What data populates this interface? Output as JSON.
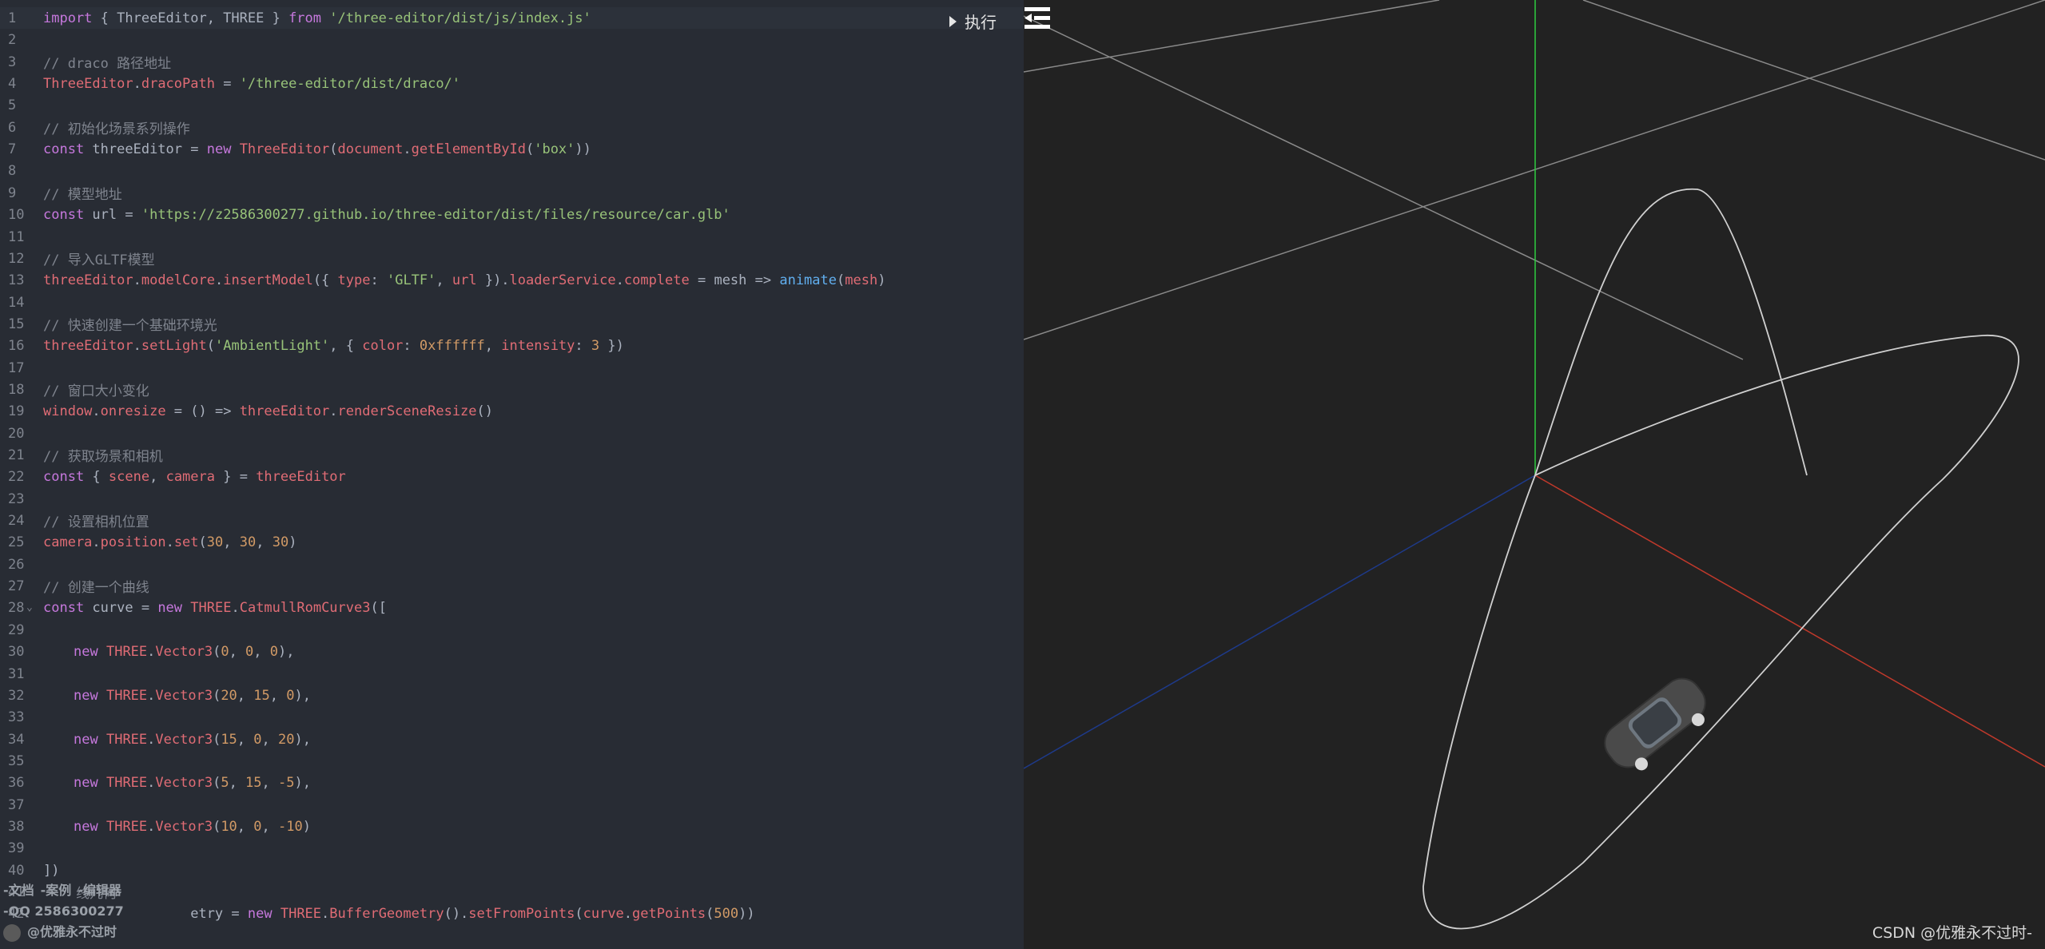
{
  "editor": {
    "lines": [
      {
        "n": "1",
        "active": true,
        "tokens": [
          [
            "kw",
            "import"
          ],
          [
            "pl",
            " { ThreeEditor, THREE } "
          ],
          [
            "kw",
            "from"
          ],
          [
            "pl",
            " "
          ],
          [
            "str",
            "'/three-editor/dist/js/index.js'"
          ]
        ]
      },
      {
        "n": "2",
        "tokens": []
      },
      {
        "n": "3",
        "tokens": [
          [
            "cm",
            "// draco 路径地址"
          ]
        ]
      },
      {
        "n": "4",
        "tokens": [
          [
            "vr",
            "ThreeEditor"
          ],
          [
            "pl",
            "."
          ],
          [
            "vr",
            "dracoPath"
          ],
          [
            "pl",
            " = "
          ],
          [
            "str",
            "'/three-editor/dist/draco/'"
          ]
        ]
      },
      {
        "n": "5",
        "tokens": []
      },
      {
        "n": "6",
        "tokens": [
          [
            "cm",
            "// 初始化场景系列操作"
          ]
        ]
      },
      {
        "n": "7",
        "tokens": [
          [
            "kw",
            "const"
          ],
          [
            "pl",
            " threeEditor = "
          ],
          [
            "kw",
            "new"
          ],
          [
            "pl",
            " "
          ],
          [
            "vr",
            "ThreeEditor"
          ],
          [
            "pl",
            "("
          ],
          [
            "vr",
            "document"
          ],
          [
            "pl",
            "."
          ],
          [
            "vr",
            "getElementById"
          ],
          [
            "pl",
            "("
          ],
          [
            "str",
            "'box'"
          ],
          [
            "pl",
            "))"
          ]
        ]
      },
      {
        "n": "8",
        "tokens": []
      },
      {
        "n": "9",
        "tokens": [
          [
            "cm",
            "// 模型地址"
          ]
        ]
      },
      {
        "n": "10",
        "tokens": [
          [
            "kw",
            "const"
          ],
          [
            "pl",
            " url = "
          ],
          [
            "str",
            "'https://z2586300277.github.io/three-editor/dist/files/resource/car.glb'"
          ]
        ]
      },
      {
        "n": "11",
        "tokens": []
      },
      {
        "n": "12",
        "tokens": [
          [
            "cm",
            "// 导入GLTF模型"
          ]
        ]
      },
      {
        "n": "13",
        "tokens": [
          [
            "vr",
            "threeEditor"
          ],
          [
            "pl",
            "."
          ],
          [
            "vr",
            "modelCore"
          ],
          [
            "pl",
            "."
          ],
          [
            "vr",
            "insertModel"
          ],
          [
            "pl",
            "({ "
          ],
          [
            "vr",
            "type"
          ],
          [
            "pl",
            ": "
          ],
          [
            "str",
            "'GLTF'"
          ],
          [
            "pl",
            ", "
          ],
          [
            "vr",
            "url"
          ],
          [
            "pl",
            " })."
          ],
          [
            "vr",
            "loaderService"
          ],
          [
            "pl",
            "."
          ],
          [
            "vr",
            "complete"
          ],
          [
            "pl",
            " = mesh => "
          ],
          [
            "fn",
            "animate"
          ],
          [
            "pl",
            "("
          ],
          [
            "vr",
            "mesh"
          ],
          [
            "pl",
            ")"
          ]
        ]
      },
      {
        "n": "14",
        "tokens": []
      },
      {
        "n": "15",
        "tokens": [
          [
            "cm",
            "// 快速创建一个基础环境光"
          ]
        ]
      },
      {
        "n": "16",
        "tokens": [
          [
            "vr",
            "threeEditor"
          ],
          [
            "pl",
            "."
          ],
          [
            "vr",
            "setLight"
          ],
          [
            "pl",
            "("
          ],
          [
            "str",
            "'AmbientLight'"
          ],
          [
            "pl",
            ", { "
          ],
          [
            "vr",
            "color"
          ],
          [
            "pl",
            ": "
          ],
          [
            "num",
            "0xffffff"
          ],
          [
            "pl",
            ", "
          ],
          [
            "vr",
            "intensity"
          ],
          [
            "pl",
            ": "
          ],
          [
            "num",
            "3"
          ],
          [
            "pl",
            " })"
          ]
        ]
      },
      {
        "n": "17",
        "tokens": []
      },
      {
        "n": "18",
        "tokens": [
          [
            "cm",
            "// 窗口大小变化"
          ]
        ]
      },
      {
        "n": "19",
        "tokens": [
          [
            "vr",
            "window"
          ],
          [
            "pl",
            "."
          ],
          [
            "vr",
            "onresize"
          ],
          [
            "pl",
            " = () => "
          ],
          [
            "vr",
            "threeEditor"
          ],
          [
            "pl",
            "."
          ],
          [
            "vr",
            "renderSceneResize"
          ],
          [
            "pl",
            "()"
          ]
        ]
      },
      {
        "n": "20",
        "tokens": []
      },
      {
        "n": "21",
        "tokens": [
          [
            "cm",
            "// 获取场景和相机"
          ]
        ]
      },
      {
        "n": "22",
        "tokens": [
          [
            "kw",
            "const"
          ],
          [
            "pl",
            " { "
          ],
          [
            "vr",
            "scene"
          ],
          [
            "pl",
            ", "
          ],
          [
            "vr",
            "camera"
          ],
          [
            "pl",
            " } = "
          ],
          [
            "vr",
            "threeEditor"
          ]
        ]
      },
      {
        "n": "23",
        "tokens": []
      },
      {
        "n": "24",
        "tokens": [
          [
            "cm",
            "// 设置相机位置"
          ]
        ]
      },
      {
        "n": "25",
        "tokens": [
          [
            "vr",
            "camera"
          ],
          [
            "pl",
            "."
          ],
          [
            "vr",
            "position"
          ],
          [
            "pl",
            "."
          ],
          [
            "vr",
            "set"
          ],
          [
            "pl",
            "("
          ],
          [
            "num",
            "30"
          ],
          [
            "pl",
            ", "
          ],
          [
            "num",
            "30"
          ],
          [
            "pl",
            ", "
          ],
          [
            "num",
            "30"
          ],
          [
            "pl",
            ")"
          ]
        ]
      },
      {
        "n": "26",
        "tokens": []
      },
      {
        "n": "27",
        "tokens": [
          [
            "cm",
            "// 创建一个曲线"
          ]
        ]
      },
      {
        "n": "28",
        "fold": true,
        "tokens": [
          [
            "kw",
            "const"
          ],
          [
            "pl",
            " curve = "
          ],
          [
            "kw",
            "new"
          ],
          [
            "pl",
            " "
          ],
          [
            "vr",
            "THREE"
          ],
          [
            "pl",
            "."
          ],
          [
            "vr",
            "CatmullRomCurve3"
          ],
          [
            "pl",
            "(["
          ]
        ]
      },
      {
        "n": "29",
        "tokens": []
      },
      {
        "n": "30",
        "indent": true,
        "tokens": [
          [
            "kw",
            "new"
          ],
          [
            "pl",
            " "
          ],
          [
            "vr",
            "THREE"
          ],
          [
            "pl",
            "."
          ],
          [
            "vr",
            "Vector3"
          ],
          [
            "pl",
            "("
          ],
          [
            "num",
            "0"
          ],
          [
            "pl",
            ", "
          ],
          [
            "num",
            "0"
          ],
          [
            "pl",
            ", "
          ],
          [
            "num",
            "0"
          ],
          [
            "pl",
            "),"
          ]
        ]
      },
      {
        "n": "31",
        "tokens": []
      },
      {
        "n": "32",
        "indent": true,
        "tokens": [
          [
            "kw",
            "new"
          ],
          [
            "pl",
            " "
          ],
          [
            "vr",
            "THREE"
          ],
          [
            "pl",
            "."
          ],
          [
            "vr",
            "Vector3"
          ],
          [
            "pl",
            "("
          ],
          [
            "num",
            "20"
          ],
          [
            "pl",
            ", "
          ],
          [
            "num",
            "15"
          ],
          [
            "pl",
            ", "
          ],
          [
            "num",
            "0"
          ],
          [
            "pl",
            "),"
          ]
        ]
      },
      {
        "n": "33",
        "tokens": []
      },
      {
        "n": "34",
        "indent": true,
        "tokens": [
          [
            "kw",
            "new"
          ],
          [
            "pl",
            " "
          ],
          [
            "vr",
            "THREE"
          ],
          [
            "pl",
            "."
          ],
          [
            "vr",
            "Vector3"
          ],
          [
            "pl",
            "("
          ],
          [
            "num",
            "15"
          ],
          [
            "pl",
            ", "
          ],
          [
            "num",
            "0"
          ],
          [
            "pl",
            ", "
          ],
          [
            "num",
            "20"
          ],
          [
            "pl",
            "),"
          ]
        ]
      },
      {
        "n": "35",
        "tokens": []
      },
      {
        "n": "36",
        "indent": true,
        "tokens": [
          [
            "kw",
            "new"
          ],
          [
            "pl",
            " "
          ],
          [
            "vr",
            "THREE"
          ],
          [
            "pl",
            "."
          ],
          [
            "vr",
            "Vector3"
          ],
          [
            "pl",
            "("
          ],
          [
            "num",
            "5"
          ],
          [
            "pl",
            ", "
          ],
          [
            "num",
            "15"
          ],
          [
            "pl",
            ", "
          ],
          [
            "num",
            "-5"
          ],
          [
            "pl",
            "),"
          ]
        ]
      },
      {
        "n": "37",
        "tokens": []
      },
      {
        "n": "38",
        "indent": true,
        "tokens": [
          [
            "kw",
            "new"
          ],
          [
            "pl",
            " "
          ],
          [
            "vr",
            "THREE"
          ],
          [
            "pl",
            "."
          ],
          [
            "vr",
            "Vector3"
          ],
          [
            "pl",
            "("
          ],
          [
            "num",
            "10"
          ],
          [
            "pl",
            ", "
          ],
          [
            "num",
            "0"
          ],
          [
            "pl",
            ", "
          ],
          [
            "num",
            "-10"
          ],
          [
            "pl",
            ")"
          ]
        ]
      },
      {
        "n": "39",
        "tokens": []
      },
      {
        "n": "40",
        "tokens": [
          [
            "pl",
            "])"
          ]
        ]
      },
      {
        "n": "41",
        "tokens": [
          [
            "pl",
            "    "
          ],
          [
            "cm",
            "线几何"
          ]
        ]
      },
      {
        "n": "42",
        "tokens": [
          [
            "pl",
            "                  etry = "
          ],
          [
            "kw",
            "new"
          ],
          [
            "pl",
            " "
          ],
          [
            "vr",
            "THREE"
          ],
          [
            "pl",
            "."
          ],
          [
            "vr",
            "BufferGeometry"
          ],
          [
            "pl",
            "()."
          ],
          [
            "vr",
            "setFromPoints"
          ],
          [
            "pl",
            "("
          ],
          [
            "vr",
            "curve"
          ],
          [
            "pl",
            "."
          ],
          [
            "vr",
            "getPoints"
          ],
          [
            "pl",
            "("
          ],
          [
            "num",
            "500"
          ],
          [
            "pl",
            "))"
          ]
        ]
      }
    ]
  },
  "toolbar": {
    "run_label": "执行"
  },
  "footer": {
    "links": [
      "-文档",
      "-案例",
      "-编辑器"
    ],
    "qq": "-QQ 2586300277",
    "author": "@优雅永不过时"
  },
  "viewport": {
    "watermark": "CSDN @优雅永不过时-",
    "colors": {
      "x_axis": "#c0392b",
      "y_axis": "#2ecc40",
      "z_axis": "#1e3a8a",
      "grid": "#8a8a8a",
      "curve": "#d0d0d0",
      "car": "#4a4a4a"
    }
  },
  "icons": {
    "menu": "menu-collapse-icon",
    "run": "play-triangle-icon"
  }
}
